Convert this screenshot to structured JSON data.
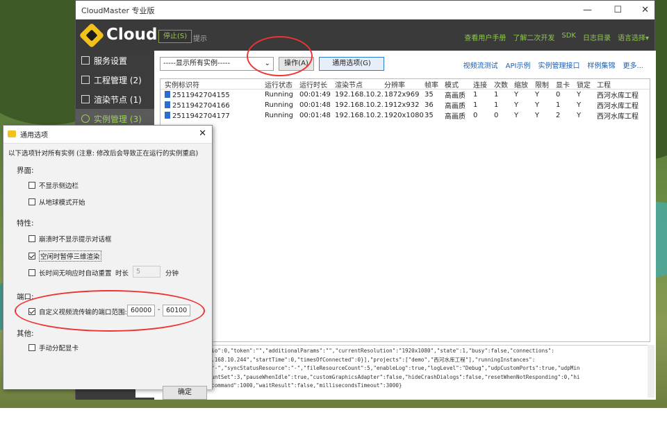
{
  "window": {
    "title": "CloudMaster 专业版",
    "min": "—",
    "max": "☐",
    "close": "✕"
  },
  "header": {
    "brand": "Cloud",
    "stop_button": "停止(S)",
    "hint": "提示",
    "links": [
      "查看用户手册",
      "了解二次开发",
      "SDK",
      "日志目录",
      "语言选择▾"
    ]
  },
  "sidebar": {
    "items": [
      {
        "label": "服务设置",
        "icon": "settings-icon"
      },
      {
        "label": "工程管理 (2)",
        "icon": "document-icon"
      },
      {
        "label": "渲染节点 (1)",
        "icon": "monitor-icon"
      },
      {
        "label": "实例管理 (3)",
        "icon": "target-icon"
      }
    ]
  },
  "toolbar": {
    "filter_value": "-----显示所有实例-----",
    "operate_button": "操作(A)",
    "general_button": "通用选项(G)",
    "links": [
      "视频流测试",
      "API示例",
      "实例管理接口",
      "样例集锦",
      "更多..."
    ]
  },
  "table": {
    "headers": [
      "实例标识符",
      "运行状态",
      "运行时长",
      "渲染节点",
      "分辨率",
      "帧率",
      "模式",
      "连接",
      "次数",
      "缩放",
      "限制",
      "显卡",
      "锁定",
      "工程"
    ],
    "rows": [
      [
        "2511942704155",
        "Running",
        "00:01:49",
        "192.168.10.2...",
        "1872x969",
        "35",
        "高画质",
        "1",
        "1",
        "Y",
        "Y",
        "0",
        "Y",
        "西河水库工程"
      ],
      [
        "2511942704166",
        "Running",
        "00:01:48",
        "192.168.10.2...",
        "1912x932",
        "36",
        "高画质",
        "1",
        "1",
        "Y",
        "Y",
        "1",
        "Y",
        "西河水库工程"
      ],
      [
        "2511942704177",
        "Running",
        "00:01:48",
        "192.168.10.2...",
        "1920x1080",
        "35",
        "高画质",
        "0",
        "0",
        "Y",
        "Y",
        "2",
        "Y",
        "西河水库工程"
      ]
    ]
  },
  "log": {
    "lines": [
      "te\":50,\"videoScalingRatio\":0,\"token\":\"\",\"additionalParams\":\"\",\"currentResolution\":\"1920x1080\",\"state\":1,\"busy\":false,\"connections\":",
      "42703559\",\"nodeIP\":\"192.168.10.244\",\"startTime\":0,\"timesOfConnected\":0}],\"projects\":[\"demo\",\"西河水库工程\"],\"runningInstances\":",
      "ue,\"syncStatusProject\":\"-\",\"syncStatusResource\":\"-\",\"fileResourceCount\":5,\"enableLog\":true,\"logLevel\":\"Debug\",\"udpCustomPorts\":true,\"udpMin",
      "Port\":60100,\"instanceCountSet\":3,\"pauseWhenIdle\":true,\"customGraphicsAdapter\":false,\"hideCrashDialogs\":false,\"resetWhenNotResponding\":0,\"hi",
      "tartFromEarth\":false},\"command\":1000,\"waitResult\":false,\"millisecondsTimeout\":3000}"
    ]
  },
  "dialog": {
    "title": "通用选项",
    "notice": "以下选项针对所有实例 (注意: 修改后会导致正在运行的实例重启)",
    "sections": {
      "ui": "界面:",
      "features": "特性:",
      "port": "端口:",
      "other": "其他:"
    },
    "options": {
      "hide_sidebar": {
        "label": "不显示侧边栏",
        "checked": false
      },
      "start_globe": {
        "label": "从地球模式开始",
        "checked": false
      },
      "crash_no_dialog": {
        "label": "崩溃时不显示提示对话框",
        "checked": false
      },
      "idle_pause": {
        "label": "空闲时暂停三维渲染",
        "checked": true
      },
      "auto_reset": {
        "label": "长时间无响应时自动重置",
        "checked": false
      },
      "duration_label": "时长",
      "duration_value": "5",
      "duration_unit": "分钟",
      "custom_ports": {
        "label": "自定义视频流传输的端口范围:",
        "checked": true
      },
      "port_min": "60000",
      "port_sep": "-",
      "port_max": "60100",
      "manual_gpu": {
        "label": "手动分配显卡",
        "checked": false
      }
    },
    "ok_button": "确定"
  }
}
